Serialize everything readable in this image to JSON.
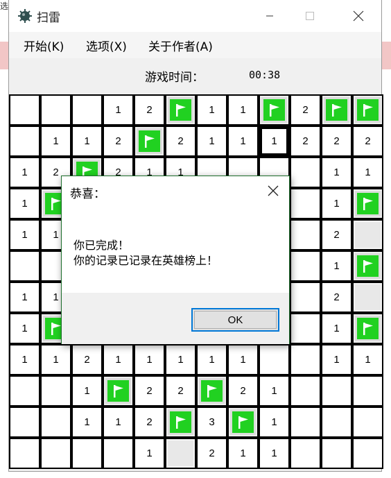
{
  "window": {
    "title": "扫雷",
    "icon": "mine-icon",
    "controls": {
      "minimize": "minimize-icon",
      "maximize": "maximize-icon",
      "close": "close-icon"
    }
  },
  "desktop_fragment": "选",
  "menu": [
    {
      "label": "开始(K)"
    },
    {
      "label": "选项(X)"
    },
    {
      "label": "关于作者(A)"
    }
  ],
  "status": {
    "time_label": "游戏时间：",
    "time_value": "00:38"
  },
  "board": {
    "rows": 12,
    "cols": 12,
    "legend": "F = flag, C = covered cell, '' = revealed empty, digits = adjacent mine count",
    "cells": [
      [
        "",
        "",
        "",
        "1",
        "2",
        "F",
        "1",
        "1",
        "F",
        "2",
        "F",
        "F"
      ],
      [
        "",
        "1",
        "1",
        "2",
        "F",
        "2",
        "1",
        "1",
        "1",
        "2",
        "2",
        "2"
      ],
      [
        "1",
        "2",
        "F",
        "2",
        "1",
        "1",
        "",
        "",
        "",
        "",
        "1",
        "1"
      ],
      [
        "1",
        "F",
        "",
        "",
        "",
        "",
        "",
        "",
        "",
        "",
        "1",
        "F"
      ],
      [
        "1",
        "1",
        "",
        "",
        "",
        "",
        "",
        "",
        "",
        "",
        "2",
        "C"
      ],
      [
        "",
        "",
        "",
        "",
        "",
        "",
        "",
        "",
        "",
        "",
        "1",
        "F"
      ],
      [
        "1",
        "1",
        "",
        "",
        "",
        "",
        "",
        "",
        "",
        "",
        "2",
        "C"
      ],
      [
        "1",
        "F",
        "",
        "",
        "",
        "",
        "",
        "",
        "",
        "",
        "1",
        "F"
      ],
      [
        "1",
        "1",
        "2",
        "1",
        "1",
        "1",
        "1",
        "1",
        "",
        "",
        "1",
        "1"
      ],
      [
        "",
        "",
        "1",
        "F",
        "2",
        "2",
        "F",
        "2",
        "1",
        "",
        "",
        ""
      ],
      [
        "",
        "",
        "1",
        "1",
        "2",
        "F",
        "3",
        "F",
        "1",
        "",
        "",
        ""
      ],
      [
        "",
        "",
        "",
        "",
        "1",
        "C",
        "2",
        "1",
        "1",
        "",
        "",
        ""
      ]
    ],
    "selected": {
      "row": 1,
      "col": 8
    },
    "colors": {
      "flag": "#21d121",
      "grid": "#000000",
      "cell": "#ffffff"
    }
  },
  "dialog": {
    "title": "恭喜：",
    "message_lines": [
      "你已完成！",
      "你的记录已记录在英雄榜上！"
    ],
    "ok_label": "OK",
    "accent": "#0078d7"
  }
}
